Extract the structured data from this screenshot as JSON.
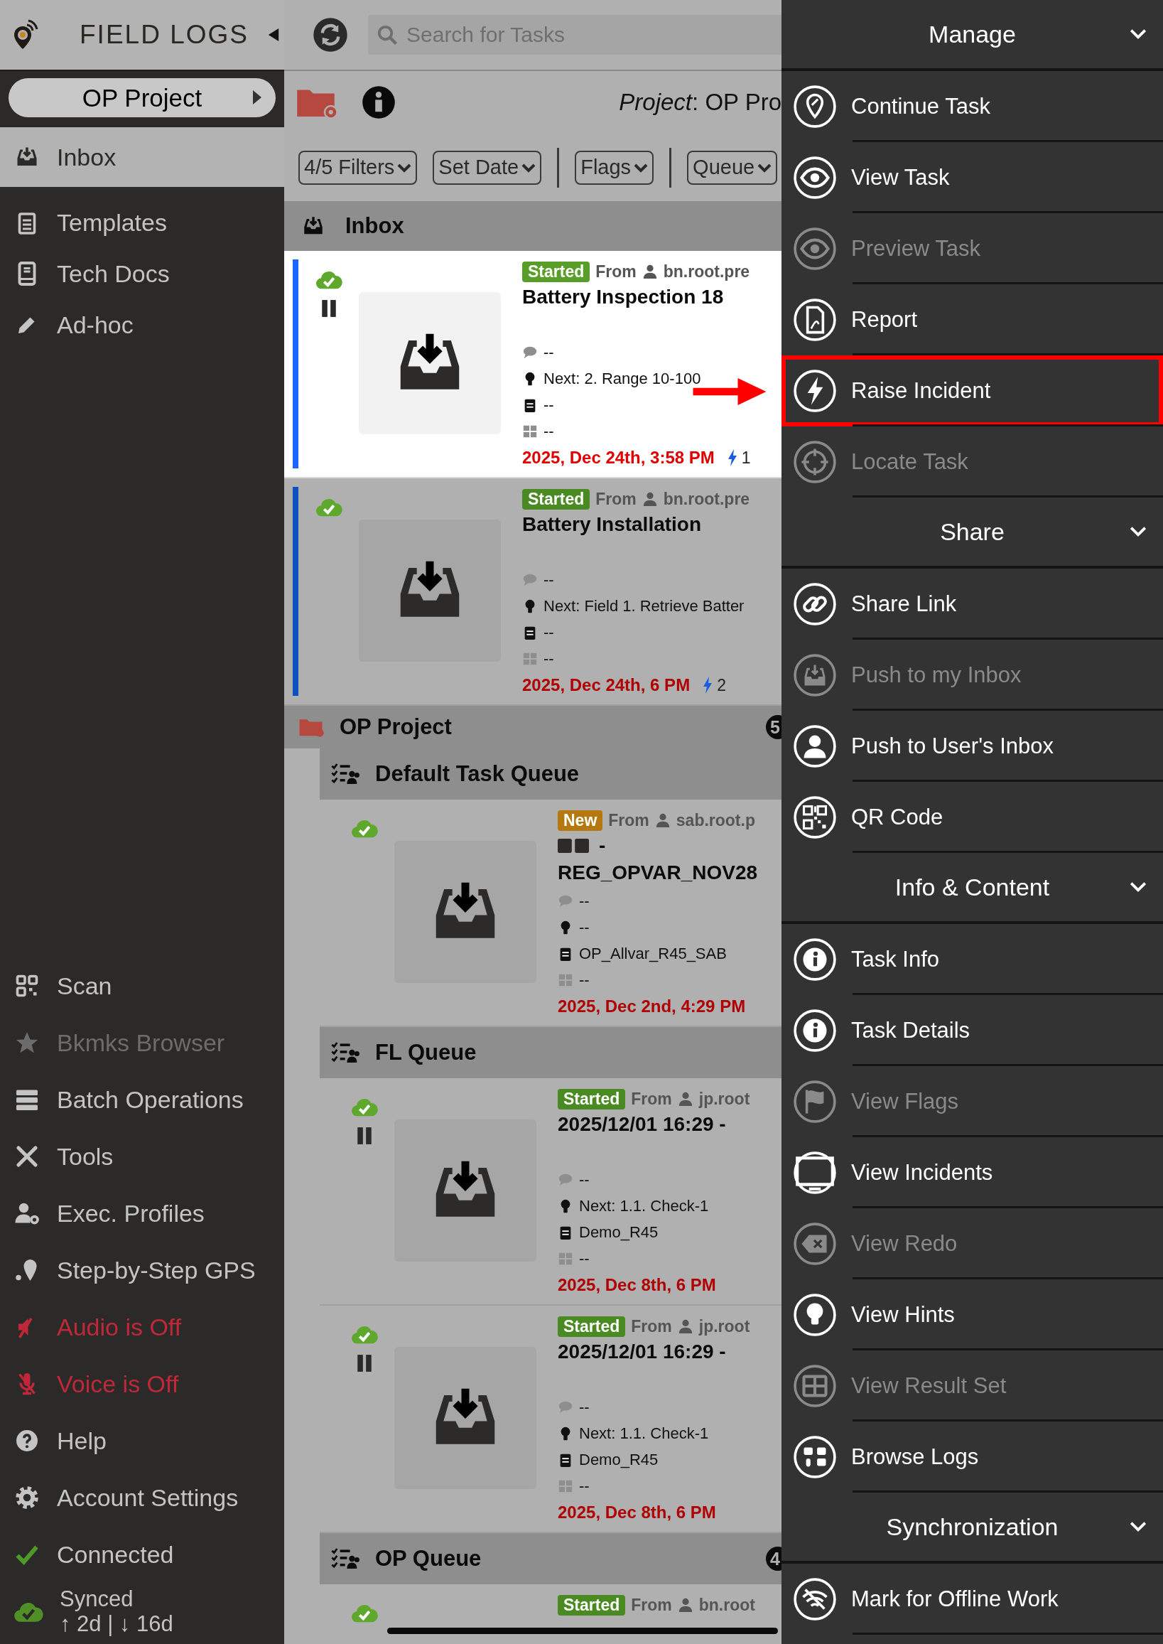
{
  "header": {
    "app_name": "FIELD LOGS"
  },
  "sidebar": {
    "project": "OP Project",
    "items": [
      {
        "label": "Inbox",
        "selected": true
      },
      {
        "label": "Templates",
        "selected": false
      },
      {
        "label": "Tech Docs",
        "selected": false
      },
      {
        "label": "Ad-hoc",
        "selected": false
      }
    ],
    "tools": [
      {
        "label": "Scan",
        "disabled": false,
        "off": false
      },
      {
        "label": "Bkmks Browser",
        "disabled": true,
        "off": false
      },
      {
        "label": "Batch Operations",
        "disabled": false,
        "off": false
      },
      {
        "label": "Tools",
        "disabled": false,
        "off": false
      },
      {
        "label": "Exec. Profiles",
        "disabled": false,
        "off": false
      },
      {
        "label": "Step-by-Step GPS",
        "disabled": false,
        "off": false
      },
      {
        "label": "Audio is Off",
        "disabled": false,
        "off": true
      },
      {
        "label": "Voice is Off",
        "disabled": false,
        "off": true
      },
      {
        "label": "Help",
        "disabled": false,
        "off": false
      },
      {
        "label": "Account Settings",
        "disabled": false,
        "off": false
      },
      {
        "label": "Connected",
        "disabled": false,
        "off": false
      }
    ],
    "sync": {
      "label": "Synced",
      "detail": "↑ 2d | ↓ 16d"
    }
  },
  "search": {
    "placeholder": "Search for Tasks"
  },
  "project_bar": {
    "title": "*Project*: OP Pro"
  },
  "filters": [
    {
      "label": "4/5 Filters"
    },
    {
      "label": "Set Date"
    },
    {
      "label": "Flags"
    },
    {
      "label": "Queue"
    }
  ],
  "inbox": {
    "title": "Inbox",
    "tasks": [
      {
        "status": "Started",
        "color": "#5a9e2a",
        "from_label": "From",
        "from": "bn.root.pre",
        "title": "Battery Inspection 18",
        "comment": "--",
        "next": "Next: 2. Range 10-100",
        "template": "--",
        "results": "--",
        "date": "2025, Dec 24th, 3:58 PM",
        "incidents": "1",
        "selected": true,
        "paused": true
      },
      {
        "status": "Started",
        "color": "#4a8a22",
        "from_label": "From",
        "from": "bn.root.pre",
        "title": "Battery Installation",
        "comment": "--",
        "next": "Next: Field 1. Retrieve Batter",
        "template": "--",
        "results": "--",
        "date": "2025, Dec 24th, 6 PM",
        "incidents": "2",
        "selected": false,
        "paused": false
      }
    ]
  },
  "project": {
    "title": "OP Project",
    "count": "5",
    "queues": [
      {
        "title": "Default Task Queue",
        "tasks": [
          {
            "status": "New",
            "color": "#b5780f",
            "from_label": "From",
            "from": "sab.root.p",
            "title": "- REG_OPVAR_NOV28",
            "title_glyphs": true,
            "comment": "--",
            "next": "--",
            "template": "OP_Allvar_R45_SAB",
            "results": "--",
            "date": "2025, Dec 2nd, 4:29 PM",
            "selected": false,
            "paused": false
          }
        ]
      },
      {
        "title": "FL Queue",
        "tasks": [
          {
            "status": "Started",
            "color": "#4a8a22",
            "from_label": "From",
            "from": "jp.root",
            "title": "2025/12/01 16:29 -",
            "comment": "--",
            "next": "Next: 1.1. Check-1",
            "template": "Demo_R45",
            "results": "--",
            "date": "2025, Dec 8th, 6 PM",
            "selected": false,
            "paused": true
          },
          {
            "status": "Started",
            "color": "#4a8a22",
            "from_label": "From",
            "from": "jp.root",
            "title": "2025/12/01 16:29 -",
            "comment": "--",
            "next": "Next: 1.1. Check-1",
            "template": "Demo_R45",
            "results": "--",
            "date": "2025, Dec 8th, 6 PM",
            "selected": false,
            "paused": true
          }
        ]
      },
      {
        "title": "OP Queue",
        "count": "4",
        "tasks": [
          {
            "status": "Started",
            "color": "#4a8a22",
            "from_label": "From",
            "from": "bn.root",
            "selected": false,
            "paused": false
          }
        ]
      }
    ]
  },
  "menu": {
    "sections": [
      {
        "title": "Manage",
        "expanded": true,
        "items": [
          {
            "label": "Continue Task",
            "disabled": false,
            "highlighted": false
          },
          {
            "label": "View Task",
            "disabled": false,
            "highlighted": false
          },
          {
            "label": "Preview Task",
            "disabled": true,
            "highlighted": false
          },
          {
            "label": "Report",
            "disabled": false,
            "highlighted": false
          },
          {
            "label": "Raise Incident",
            "disabled": false,
            "highlighted": true
          },
          {
            "label": "Locate Task",
            "disabled": true,
            "highlighted": false
          }
        ]
      },
      {
        "title": "Share",
        "expanded": true,
        "items": [
          {
            "label": "Share Link",
            "disabled": false,
            "highlighted": false
          },
          {
            "label": "Push to my Inbox",
            "disabled": true,
            "highlighted": false
          },
          {
            "label": "Push to User's Inbox",
            "disabled": false,
            "highlighted": false
          },
          {
            "label": "QR Code",
            "disabled": false,
            "highlighted": false
          }
        ]
      },
      {
        "title": "Info & Content",
        "expanded": true,
        "items": [
          {
            "label": "Task Info",
            "disabled": false,
            "highlighted": false
          },
          {
            "label": "Task Details",
            "disabled": false,
            "highlighted": false
          },
          {
            "label": "View Flags",
            "disabled": true,
            "highlighted": false
          },
          {
            "label": "View Incidents",
            "disabled": false,
            "highlighted": false
          },
          {
            "label": "View Redo",
            "disabled": true,
            "highlighted": false
          },
          {
            "label": "View Hints",
            "disabled": false,
            "highlighted": false
          },
          {
            "label": "View Result Set",
            "disabled": true,
            "highlighted": false
          },
          {
            "label": "Browse Logs",
            "disabled": false,
            "highlighted": false
          }
        ]
      },
      {
        "title": "Synchronization",
        "expanded": true,
        "items": [
          {
            "label": "Mark for Offline Work",
            "disabled": false,
            "highlighted": false
          }
        ]
      }
    ]
  }
}
